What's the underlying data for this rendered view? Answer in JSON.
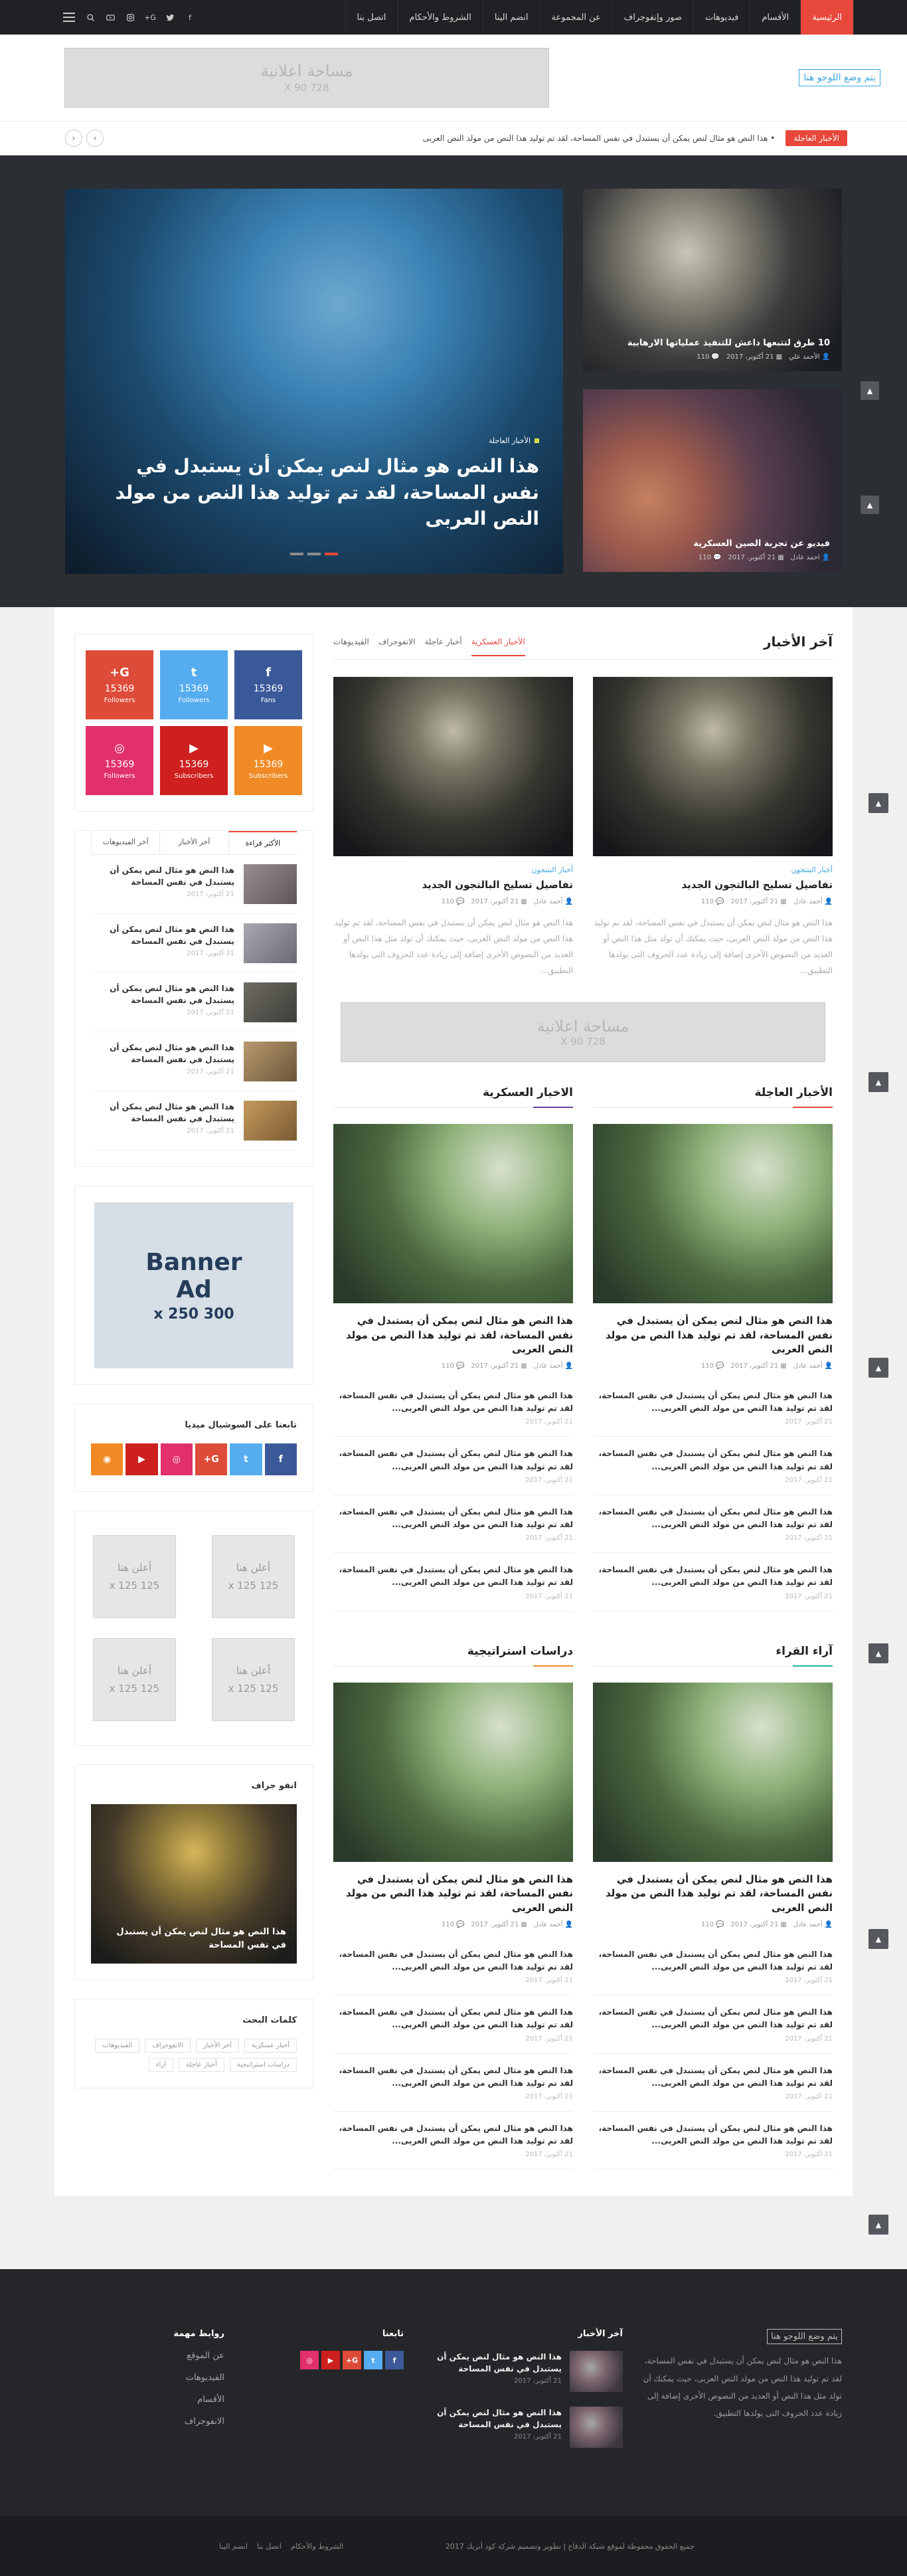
{
  "nav": {
    "items": [
      "الرئيسية",
      "الأقسام",
      "فيديوهات",
      "صور وإنفوجراف",
      "عن المجموعة",
      "انضم الينا",
      "الشروط والأحكام",
      "اتصل بنا"
    ],
    "icons": [
      "facebook-icon",
      "twitter-icon",
      "google-plus-icon",
      "instagram-icon",
      "youtube-icon",
      "search-icon",
      "menu-icon"
    ]
  },
  "header": {
    "logo": "يتم وضع اللوجو هنا",
    "ad_line1": "مساحة اعلانية",
    "ad_line2": "728 X 90"
  },
  "ticker": {
    "label": "الأخبار العاجلة",
    "text": "هذا النص هو مثال لنص يمكن أن يستبدل في نفس المساحة، لقد تم توليد هذا النص من مولد النص العربى"
  },
  "hero": {
    "main": {
      "category": "الأخبار العاجلة",
      "title": "هذا النص هو مثال لنص يمكن أن يستبدل في نفس المساحة، لقد تم توليد هذا النص من مولد النص العربى"
    },
    "side": [
      {
        "title": "10 طرق لتتبعها داعش للتنفيذ عملياتها الارهابية",
        "author": "الأحمد علي",
        "date": "21 أكتوبر، 2017",
        "comments": "110"
      },
      {
        "title": "فيديو عن تجربة الصين العسكرية",
        "author": "احمد عادل",
        "date": "21 أكتوبر، 2017",
        "comments": "110"
      }
    ]
  },
  "latest": {
    "title": "آخر الأخبار",
    "filters": [
      "الأخبار العسكرية",
      "أخبار عاجلة",
      "الانفوجراف",
      "الفيديوهات"
    ],
    "cards": [
      {
        "category": "أخبار البتنجون",
        "title": "تفاصيل تسليح البالتجون الجديد",
        "author": "أحمد عادل",
        "date": "21 أكتوبر، 2017",
        "comments": "110",
        "excerpt": "هذا النص هو مثال لنص يمكن أن يستبدل في نفس المساحة، لقد تم توليد هذا النص من مولد النص العربى، حيث يمكنك أن تولد مثل هذا النص أو العديد من النصوص الأخرى إضافة إلى زيادة عدد الحروف التى يولدها التطبيق..."
      },
      {
        "category": "أخبار البتنجون",
        "title": "تفاصيل تسليح البالتجون الجديد",
        "author": "أحمد عادل",
        "date": "21 أكتوبر، 2017",
        "comments": "110",
        "excerpt": "هذا النص هو مثال لنص يمكن أن يستبدل في نفس المساحة، لقد تم توليد هذا النص من مولد النص العربى، حيث يمكنك أن تولد مثل هذا النص أو العديد من النصوص الأخرى إضافة إلى زيادة عدد الحروف التى يولدها التطبيق..."
      }
    ],
    "ad_line1": "مساحة اعلانية",
    "ad_line2": "728 X 90"
  },
  "blocks": [
    {
      "right_title": "الأخبار العاجلة",
      "left_title": "الاخبار العسكرية",
      "right_color": "#e8473b",
      "left_color": "#6a3fa0",
      "feature_title": "هذا النص هو مثال لنص يمكن أن يستبدل في نفس المساحة، لقد تم توليد هذا النص من مولد النص العربى",
      "author": "أحمد عادل",
      "date": "21 أكتوبر، 2017",
      "comments": "110",
      "item": "هذا النص هو مثال لنص يمكن أن يستبدل في نفس المساحة، لقد تم توليد هذا النص من مولد النص العربى...",
      "item_date": "21 أكتوبر، 2017"
    },
    {
      "right_title": "آراء القراء",
      "left_title": "دراسات استراتيجية",
      "right_color": "#1fb5a6",
      "left_color": "#e98b2f",
      "feature_title": "هذا النص هو مثال لنص يمكن أن يستبدل في نفس المساحة، لقد تم توليد هذا النص من مولد النص العربى",
      "author": "أحمد عادل",
      "date": "21 أكتوبر، 2017",
      "comments": "110",
      "item": "هذا النص هو مثال لنص يمكن أن يستبدل في نفس المساحة، لقد تم توليد هذا النص من مولد النص العربى...",
      "item_date": "21 أكتوبر، 2017"
    }
  ],
  "sidebar": {
    "social": [
      {
        "icon": "f",
        "count": "15369",
        "label": "Fans",
        "color": "#3b5998"
      },
      {
        "icon": "t",
        "count": "15369",
        "label": "Followers",
        "color": "#55acee"
      },
      {
        "icon": "G+",
        "count": "15369",
        "label": "Followers",
        "color": "#dd4b39"
      },
      {
        "icon": "▶",
        "count": "15369",
        "label": "Subscribers",
        "color": "#f08a24"
      },
      {
        "icon": "▶",
        "count": "15369",
        "label": "Subscribers",
        "color": "#cd201f"
      },
      {
        "icon": "◎",
        "count": "15369",
        "label": "Followers",
        "color": "#e1306c"
      }
    ],
    "tabs": [
      "الأكثر قراءة",
      "آخر الأخبار",
      "آخر الفيديوهات"
    ],
    "tab_item_title": "هذا النص هو مثال لنص يمكن أن يستبدل في نفس المساحة",
    "tab_item_date": "21 أكتوبر، 2017",
    "banner_line1": "Banner",
    "banner_line2": "Ad",
    "banner_line3": "300 x 250",
    "follow_title": "تابعنا على السوشيال ميديا",
    "ad125_line1": "أعلن هنا",
    "ad125_line2": "125 x 125",
    "infographic_title": "انفو جراف",
    "infographic_caption": "هذا النص هو مثال لنص يمكن أن يستبدل في نفس المساحة",
    "tags_title": "كلمات البحث",
    "tags": [
      "أخبار عسكرية",
      "آخر الأخبار",
      "الانفوجراف",
      "الفيديوهات",
      "دراسات استراتيجية",
      "أخبار عاجلة",
      "آراء"
    ]
  },
  "footer": {
    "logo": "يتم وضع اللوجو هنا",
    "about": "هذا النص هو مثال لنص يمكن أن يستبدل في نفس المساحة، لقد تم توليد هذا النص من مولد النص العربى، حيث يمكنك أن تولد مثل هذا النص أو العديد من النصوص الأخرى إضافة إلى زيادة عدد الحروف التى يولدها التطبيق.",
    "latest_title": "آخر الأخبار",
    "post_title": "هذا النص هو مثال لنص يمكن أن يستبدل في نفس المساحة",
    "post_date": "21 أكتوبر، 2017",
    "follow_title": "تابعنا",
    "links_title": "روابط مهمة",
    "links": [
      "عن الموقع",
      "الفيديوهات",
      "الأقسام",
      "الانفوجراف"
    ],
    "copyright": "جميع الحقوق محفوظة لموقع شبكة الدفاع | تطوير وتصميم شركة كود أنربك 2017",
    "bottom_links": [
      "الشروط والأحكام",
      "اتصل بنا",
      "انضم الينا"
    ]
  }
}
